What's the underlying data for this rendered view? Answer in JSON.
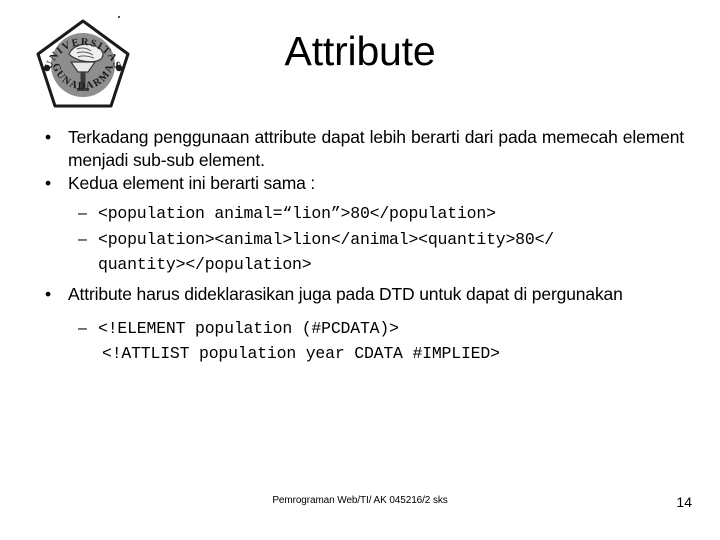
{
  "slide": {
    "title": "Attribute",
    "logo": {
      "icon_name": "universitas-gunadarma-logo",
      "top_text": "UNIVERSITAS",
      "bottom_text": "GUNADARMA"
    },
    "bullets": [
      {
        "level": 1,
        "marker": "•",
        "text": "Terkadang penggunaan attribute dapat lebih berarti dari pada memecah element menjadi sub-sub element.",
        "justified": true
      },
      {
        "level": 1,
        "marker": "•",
        "text": "Kedua element ini berarti sama :",
        "justified": false
      },
      {
        "level": 2,
        "marker": "–",
        "text": "<population animal=“lion”>80</population>",
        "continuation": ""
      },
      {
        "level": 2,
        "marker": "–",
        "text": "<population><animal>lion</animal><quantity>80</",
        "continuation": "quantity></population>"
      },
      {
        "level": 1,
        "marker": "•",
        "text": "Attribute harus dideklarasikan juga pada DTD untuk dapat di pergunakan",
        "justified": true
      },
      {
        "level": 2,
        "marker": "–",
        "text": "<!ELEMENT population (#PCDATA)>",
        "continuation": "<!ATTLIST population year CDATA #IMPLIED>"
      }
    ],
    "footer": {
      "course": "Pemrograman Web/TI/ AK 045216/2 sks",
      "page_number": "14"
    }
  }
}
